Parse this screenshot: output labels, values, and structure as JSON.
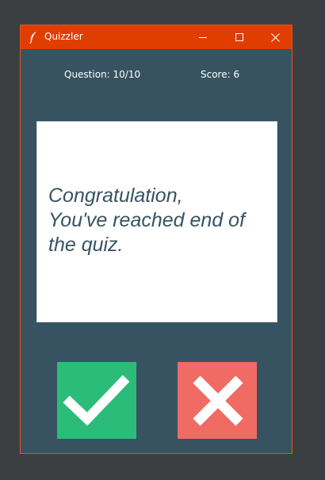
{
  "window": {
    "title": "Quizzler",
    "icon": "feather-icon",
    "controls": [
      "minimize-icon",
      "maximize-icon",
      "close-icon"
    ],
    "titlebar_color": "#e03e00"
  },
  "quiz": {
    "question_label": "Question: 10/10",
    "score_label": "Score: 6",
    "card_text": "Congratulation,\nYou've reached end of\nthe quiz."
  },
  "buttons": {
    "true_icon": "check-icon",
    "false_icon": "x-icon"
  },
  "colors": {
    "background": "#375362",
    "card": "#ffffff",
    "card_text": "#375362",
    "true_button": "#2bbc7a",
    "false_button": "#ef6b63"
  }
}
